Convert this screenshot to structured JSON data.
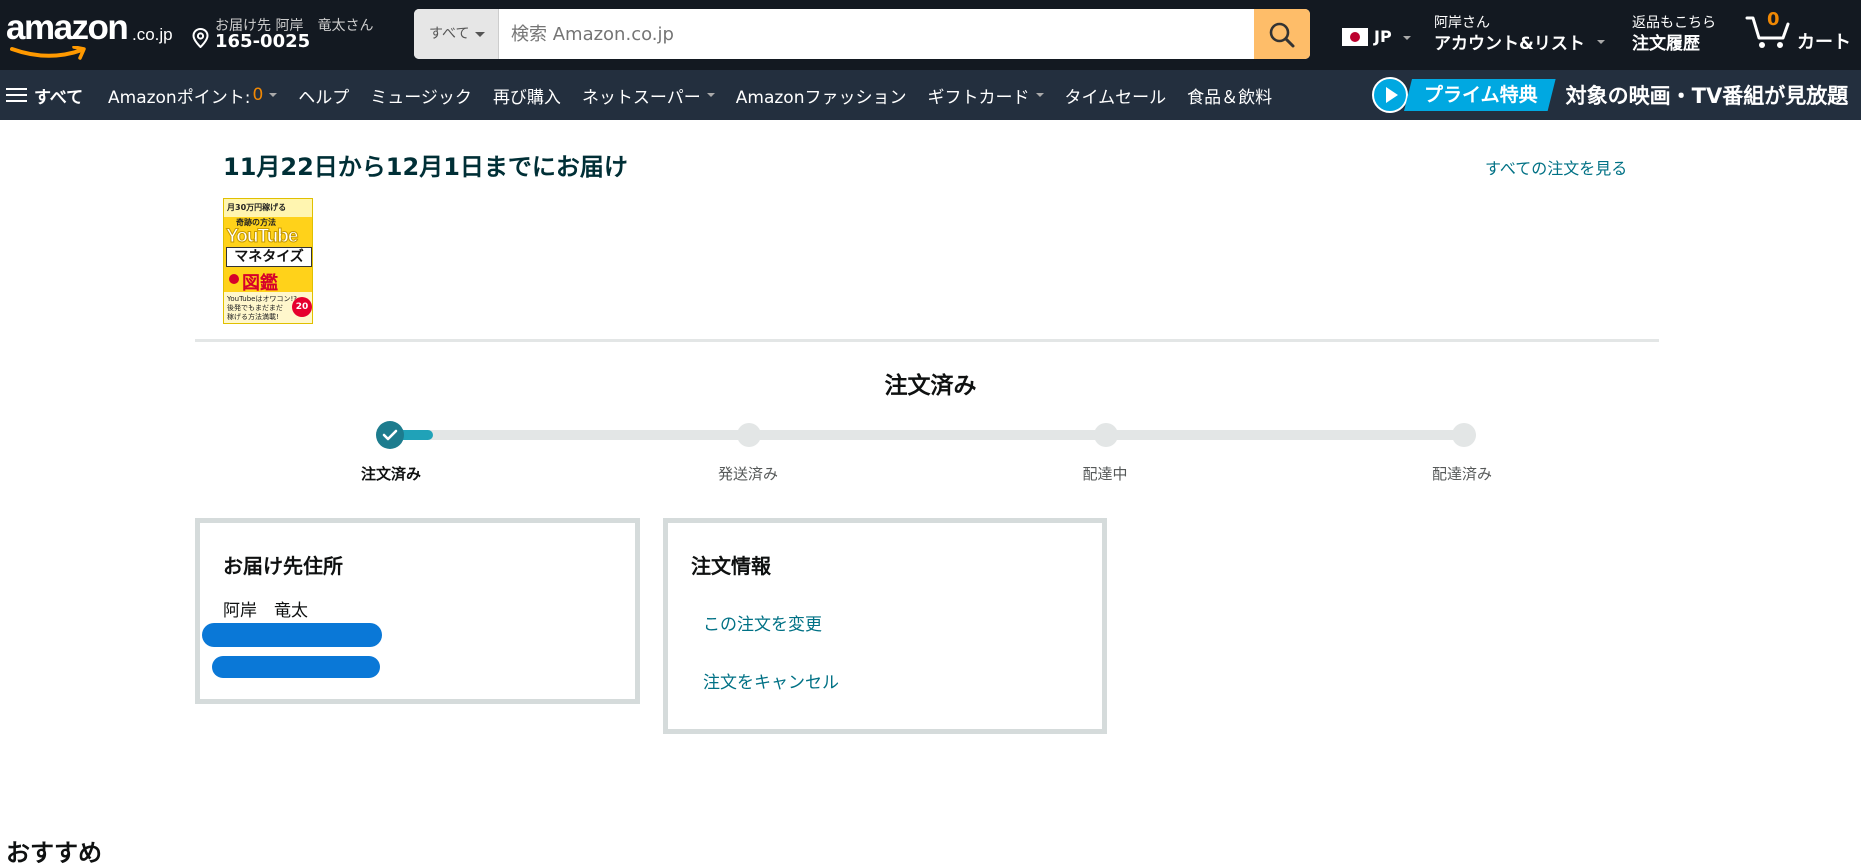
{
  "header": {
    "logo_text": "amazon",
    "logo_tld": ".co.jp",
    "deliver_line1": "お届け先 阿岸　竜太さん",
    "deliver_line2": "165-0025",
    "search_category": "すべて",
    "search_placeholder": "検索 Amazon.co.jp",
    "lang_code": "JP",
    "account_line1": "阿岸さん",
    "account_line2": "アカウント&リスト",
    "orders_line1": "返品もこちら",
    "orders_line2": "注文履歴",
    "cart_count": "0",
    "cart_label": "カート"
  },
  "subnav": {
    "all_label": "すべて",
    "items": [
      {
        "label": "Amazonポイント:",
        "points": "0"
      },
      {
        "label": "ヘルプ"
      },
      {
        "label": "ミュージック"
      },
      {
        "label": "再び購入"
      },
      {
        "label": "ネットスーパー"
      },
      {
        "label": "Amazonファッション"
      },
      {
        "label": "ギフトカード"
      },
      {
        "label": "タイムセール"
      },
      {
        "label": "食品＆飲料"
      }
    ],
    "prime_badge": "プライム特典",
    "prime_promo": "対象の映画・TV番組が見放題"
  },
  "order": {
    "delivery_title": "11月22日から12月1日までにお届け",
    "all_orders_link": "すべての注文を見る",
    "book": {
      "line1": "月30万円稼げる",
      "line2": "奇跡の方法",
      "title_en": "YouTube",
      "title_jp": "マネタイズ",
      "title_zukan": "図鑑",
      "line3": "YouTubeはオワコン!?",
      "line4": "後発でもまだまだ",
      "line5": "稼げる方法満載!",
      "badge": "20"
    },
    "status_title": "注文済み",
    "progress_fraction": 0.04,
    "steps": [
      "注文済み",
      "発送済み",
      "配達中",
      "配達済み"
    ],
    "address_heading": "お届け先住所",
    "address_name": "阿岸　竜太",
    "info_heading": "注文情報",
    "change_link": "この注文を変更",
    "cancel_link": "注文をキャンセル"
  },
  "recommend": {
    "title": "おすすめ",
    "right": ""
  },
  "colors": {
    "nav_top": "#131921",
    "nav_sub": "#232f3e",
    "search_button": "#febd69",
    "link": "#007185",
    "progress": "#20a2b8",
    "check": "#1d7c8e"
  }
}
